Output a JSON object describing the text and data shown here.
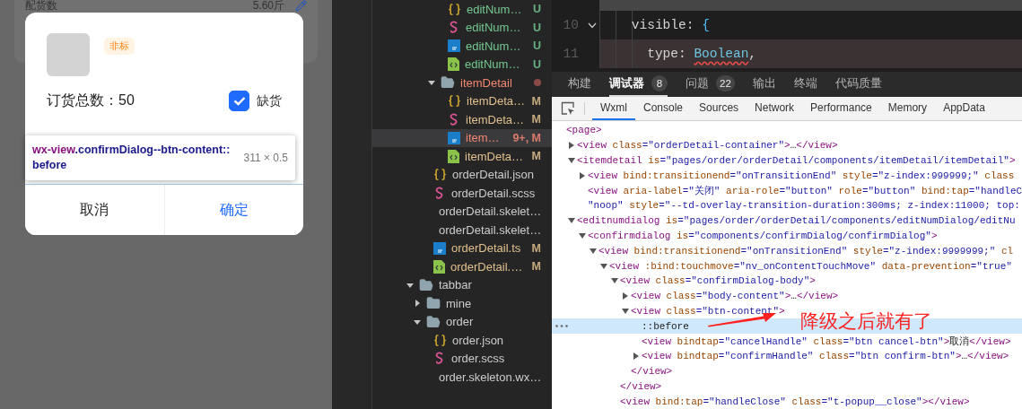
{
  "simulator": {
    "background_row": {
      "label": "配货数",
      "value": "5.60斤"
    },
    "dialog": {
      "tag": "非标",
      "total_label": "订货总数：",
      "total_value": "50",
      "checkbox": {
        "label": "缺货",
        "checked": true
      },
      "buttons": [
        {
          "label": "取消",
          "kind": "cancel"
        },
        {
          "label": "确定",
          "kind": "confirm"
        }
      ]
    },
    "inspector_tooltip": {
      "tag": "wx-view",
      "selector": ".confirmDialog--btn-content::before",
      "size": "311 × 0.5"
    }
  },
  "explorer": {
    "items": [
      {
        "kind": "scrolled",
        "children": [
          {
            "kind": "scrolled",
            "children": [
              {
                "kind": "scrolled",
                "children": [
                  {
                    "kind": "scrolled",
                    "children": [
                      {
                        "label": "editNum…",
                        "kind": "json",
                        "color": "#73c991",
                        "status": "U",
                        "selected": false
                      },
                      {
                        "label": "editNum…",
                        "kind": "scss",
                        "color": "#73c991",
                        "status": "U",
                        "selected": false
                      },
                      {
                        "label": "editNum…",
                        "kind": "ts",
                        "color": "#73c991",
                        "status": "U",
                        "selected": false
                      },
                      {
                        "label": "editNum…",
                        "kind": "wxml",
                        "color": "#73c991",
                        "status": "U",
                        "selected": false
                      }
                    ]
                  },
                  {
                    "label": "itemDetail",
                    "kind": "folder",
                    "expanded": true,
                    "color": "#f48771",
                    "selected": false,
                    "children": [
                      {
                        "label": "itemDeta…",
                        "kind": "json",
                        "color": "#e2c08d",
                        "status": "M",
                        "selected": false
                      },
                      {
                        "label": "itemDeta…",
                        "kind": "scss",
                        "color": "#e2c08d",
                        "status": "M",
                        "selected": false
                      },
                      {
                        "label": "item…",
                        "kind": "ts",
                        "color": "#f48771",
                        "status": "9+, M",
                        "selected": true
                      },
                      {
                        "label": "itemDeta…",
                        "kind": "wxml",
                        "color": "#e2c08d",
                        "status": "M",
                        "selected": false
                      }
                    ]
                  }
                ]
              },
              {
                "label": "orderDetail.json",
                "kind": "json",
                "selected": false
              },
              {
                "label": "orderDetail.scss",
                "kind": "scss",
                "selected": false
              },
              {
                "label": "orderDetail.skelet…",
                "kind": "wxml",
                "selected": false
              },
              {
                "label": "orderDetail.skelet…",
                "kind": "wxss",
                "selected": false
              },
              {
                "label": "orderDetail.ts",
                "kind": "ts",
                "color": "#e2c08d",
                "status": "M",
                "selected": false
              },
              {
                "label": "orderDetail.…",
                "kind": "wxml",
                "color": "#e2c08d",
                "status": "M",
                "selected": false
              }
            ]
          }
        ]
      },
      {
        "label": "tabbar",
        "kind": "folder",
        "expanded": true,
        "selected": false,
        "children": [
          {
            "label": "mine",
            "kind": "folder",
            "expanded": false,
            "selected": false
          },
          {
            "label": "order",
            "kind": "folder",
            "expanded": true,
            "selected": false,
            "children": [
              {
                "label": "order.json",
                "kind": "json",
                "selected": false
              },
              {
                "label": "order.scss",
                "kind": "scss",
                "selected": false
              },
              {
                "label": "order.skeleton.wx…",
                "kind": "wxml",
                "selected": false
              }
            ]
          }
        ]
      }
    ]
  },
  "editor": {
    "lines": [
      {
        "number": "10",
        "foldable": true,
        "error": false,
        "tokens": [
          {
            "kind": "property",
            "text": "    visible"
          },
          {
            "kind": "punct",
            "text": ": "
          },
          {
            "kind": "brace",
            "text": "{"
          }
        ]
      },
      {
        "number": "11",
        "foldable": false,
        "error": true,
        "tokens": [
          {
            "kind": "property",
            "text": "      type"
          },
          {
            "kind": "punct",
            "text": ": "
          },
          {
            "kind": "type",
            "text": "Boolean",
            "squiggle": true
          },
          {
            "kind": "punct",
            "text": ","
          }
        ]
      }
    ]
  },
  "panel_tabs": [
    {
      "label": "构建",
      "selected": false
    },
    {
      "label": "调试器",
      "badge": "8",
      "selected": true
    },
    {
      "label": "问题",
      "badge": "22",
      "selected": false
    },
    {
      "label": "输出",
      "selected": false
    },
    {
      "label": "终端",
      "selected": false
    },
    {
      "label": "代码质量",
      "selected": false
    }
  ],
  "devtools_tabs": [
    {
      "label": "Wxml",
      "selected": true
    },
    {
      "label": "Console",
      "selected": false
    },
    {
      "label": "Sources",
      "selected": false
    },
    {
      "label": "Network",
      "selected": false
    },
    {
      "label": "Performance",
      "selected": false
    },
    {
      "label": "Memory",
      "selected": false
    },
    {
      "label": "AppData",
      "selected": false
    }
  ],
  "xml_tree": [
    {
      "selected": false,
      "rows": [
        [
          {
            "kind": "tag",
            "text": "<page>"
          }
        ]
      ],
      "children": [
        {
          "selected": false,
          "expanded": false,
          "rows": [
            [
              {
                "kind": "tag",
                "text": "<view"
              },
              {
                "kind": "attr",
                "text": " class"
              },
              {
                "kind": "value",
                "text": "=\"orderDetail-container\""
              },
              {
                "kind": "tag",
                "text": ">"
              },
              {
                "kind": "text",
                "text": "…"
              },
              {
                "kind": "tag",
                "text": "</view>"
              }
            ]
          ]
        },
        {
          "selected": false,
          "expanded": true,
          "rows": [
            [
              {
                "kind": "tag",
                "text": "<itemdetail"
              },
              {
                "kind": "attr",
                "text": " is"
              },
              {
                "kind": "value",
                "text": "=\"pages/order/orderDetail/components/itemDetail/itemDetail\""
              },
              {
                "kind": "tag",
                "text": ">"
              }
            ]
          ],
          "children": [
            {
              "selected": false,
              "expanded": false,
              "rows": [
                [
                  {
                    "kind": "tag",
                    "text": "<view"
                  },
                  {
                    "kind": "attr",
                    "text": " bind:transitionend"
                  },
                  {
                    "kind": "value",
                    "text": "=\"onTransitionEnd\""
                  },
                  {
                    "kind": "attr",
                    "text": " style"
                  },
                  {
                    "kind": "value",
                    "text": "=\"z-index:999999;\""
                  },
                  {
                    "kind": "attr",
                    "text": " class"
                  }
                ]
              ]
            },
            {
              "selected": false,
              "rows": [
                [
                  {
                    "kind": "tag",
                    "text": "<view"
                  },
                  {
                    "kind": "attr",
                    "text": " aria-label"
                  },
                  {
                    "kind": "value",
                    "text": "=\"关闭\""
                  },
                  {
                    "kind": "attr",
                    "text": " aria-role"
                  },
                  {
                    "kind": "value",
                    "text": "=\"button\""
                  },
                  {
                    "kind": "attr",
                    "text": " role"
                  },
                  {
                    "kind": "value",
                    "text": "=\"button\""
                  },
                  {
                    "kind": "attr",
                    "text": " bind:tap"
                  },
                  {
                    "kind": "value",
                    "text": "=\"handleC"
                  }
                ],
                [
                  {
                    "kind": "value",
                    "text": "\"noop\""
                  },
                  {
                    "kind": "attr",
                    "text": " style"
                  },
                  {
                    "kind": "value",
                    "text": "=\"--td-overlay-transition-duration:300ms; z-index:11000; top:"
                  }
                ]
              ]
            }
          ]
        },
        {
          "selected": false,
          "expanded": true,
          "rows": [
            [
              {
                "kind": "tag",
                "text": "<editnumdialog"
              },
              {
                "kind": "attr",
                "text": " is"
              },
              {
                "kind": "value",
                "text": "=\"pages/order/orderDetail/components/editNumDialog/editNu"
              }
            ]
          ],
          "children": [
            {
              "selected": false,
              "expanded": true,
              "rows": [
                [
                  {
                    "kind": "tag",
                    "text": "<confirmdialog"
                  },
                  {
                    "kind": "attr",
                    "text": " is"
                  },
                  {
                    "kind": "value",
                    "text": "=\"components/confirmDialog/confirmDialog\""
                  },
                  {
                    "kind": "tag",
                    "text": ">"
                  }
                ]
              ],
              "children": [
                {
                  "selected": false,
                  "expanded": true,
                  "rows": [
                    [
                      {
                        "kind": "tag",
                        "text": "<view"
                      },
                      {
                        "kind": "attr",
                        "text": " bind:transitionend"
                      },
                      {
                        "kind": "value",
                        "text": "=\"onTransitionEnd\""
                      },
                      {
                        "kind": "attr",
                        "text": " style"
                      },
                      {
                        "kind": "value",
                        "text": "=\"z-index:9999999;\""
                      },
                      {
                        "kind": "attr",
                        "text": " cl"
                      }
                    ]
                  ],
                  "children": [
                    {
                      "selected": false,
                      "expanded": true,
                      "rows": [
                        [
                          {
                            "kind": "tag",
                            "text": "<view"
                          },
                          {
                            "kind": "attr",
                            "text": " :bind:touchmove"
                          },
                          {
                            "kind": "value",
                            "text": "=\"nv_onContentTouchMove\""
                          },
                          {
                            "kind": "attr",
                            "text": " data-prevention"
                          },
                          {
                            "kind": "value",
                            "text": "=\"true\""
                          }
                        ]
                      ],
                      "children": [
                        {
                          "selected": false,
                          "expanded": true,
                          "rows": [
                            [
                              {
                                "kind": "tag",
                                "text": "<view"
                              },
                              {
                                "kind": "attr",
                                "text": " class"
                              },
                              {
                                "kind": "value",
                                "text": "=\"confirmDialog-body\""
                              },
                              {
                                "kind": "tag",
                                "text": ">"
                              }
                            ]
                          ],
                          "close": [
                            {
                              "kind": "tag",
                              "text": "</view>"
                            }
                          ],
                          "children": [
                            {
                              "selected": false,
                              "expanded": false,
                              "rows": [
                                [
                                  {
                                    "kind": "tag",
                                    "text": "<view"
                                  },
                                  {
                                    "kind": "attr",
                                    "text": " class"
                                  },
                                  {
                                    "kind": "value",
                                    "text": "=\"body-content\""
                                  },
                                  {
                                    "kind": "tag",
                                    "text": ">"
                                  },
                                  {
                                    "kind": "text",
                                    "text": "…"
                                  },
                                  {
                                    "kind": "tag",
                                    "text": "</view>"
                                  }
                                ]
                              ]
                            },
                            {
                              "selected": false,
                              "expanded": true,
                              "rows": [
                                [
                                  {
                                    "kind": "tag",
                                    "text": "<view"
                                  },
                                  {
                                    "kind": "attr",
                                    "text": " class"
                                  },
                                  {
                                    "kind": "value",
                                    "text": "=\"btn-content\""
                                  },
                                  {
                                    "kind": "tag",
                                    "text": ">"
                                  }
                                ]
                              ],
                              "close": [
                                {
                                  "kind": "tag",
                                  "text": "</view>"
                                }
                              ],
                              "children": [
                                {
                                  "selected": true,
                                  "rows": [
                                    [
                                      {
                                        "kind": "pseudo",
                                        "text": "::before"
                                      }
                                    ]
                                  ]
                                },
                                {
                                  "selected": false,
                                  "rows": [
                                    [
                                      {
                                        "kind": "tag",
                                        "text": "<view"
                                      },
                                      {
                                        "kind": "attr",
                                        "text": " bindtap"
                                      },
                                      {
                                        "kind": "value",
                                        "text": "=\"cancelHandle\""
                                      },
                                      {
                                        "kind": "attr",
                                        "text": " class"
                                      },
                                      {
                                        "kind": "value",
                                        "text": "=\"btn cancel-btn\""
                                      },
                                      {
                                        "kind": "tag",
                                        "text": ">"
                                      },
                                      {
                                        "kind": "text",
                                        "text": "取消"
                                      },
                                      {
                                        "kind": "tag",
                                        "text": "</view>"
                                      }
                                    ]
                                  ]
                                },
                                {
                                  "selected": false,
                                  "expanded": false,
                                  "rows": [
                                    [
                                      {
                                        "kind": "tag",
                                        "text": "<view"
                                      },
                                      {
                                        "kind": "attr",
                                        "text": " bindtap"
                                      },
                                      {
                                        "kind": "value",
                                        "text": "=\"confirmHandle\""
                                      },
                                      {
                                        "kind": "attr",
                                        "text": " class"
                                      },
                                      {
                                        "kind": "value",
                                        "text": "=\"btn confirm-btn\""
                                      },
                                      {
                                        "kind": "tag",
                                        "text": ">"
                                      },
                                      {
                                        "kind": "text",
                                        "text": "…"
                                      },
                                      {
                                        "kind": "tag",
                                        "text": "</view>"
                                      }
                                    ]
                                  ]
                                }
                              ]
                            }
                          ]
                        },
                        {
                          "selected": false,
                          "rows": [
                            [
                              {
                                "kind": "tag",
                                "text": "<view"
                              },
                              {
                                "kind": "attr",
                                "text": " bind:tap"
                              },
                              {
                                "kind": "value",
                                "text": "=\"handleClose\""
                              },
                              {
                                "kind": "attr",
                                "text": " class"
                              },
                              {
                                "kind": "value",
                                "text": "=\"t-popup__close\""
                              },
                              {
                                "kind": "tag",
                                "text": "></view>"
                              }
                            ]
                          ]
                        }
                      ]
                    }
                  ]
                }
              ]
            }
          ]
        }
      ]
    }
  ],
  "annotation": {
    "text": "降级之后就有了"
  }
}
